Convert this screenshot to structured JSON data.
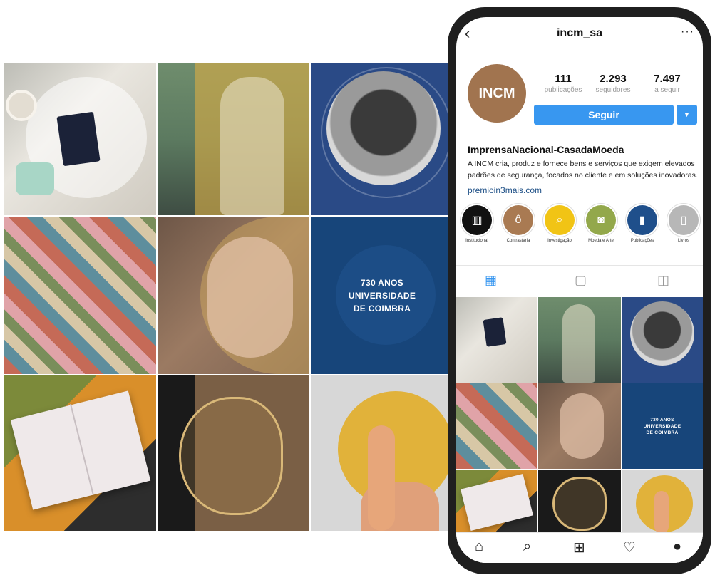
{
  "grid": {
    "tile6_text": [
      "730 ANOS",
      "UNIVERSIDADE",
      "DE COIMBRA"
    ]
  },
  "phone": {
    "topbar": {
      "back_icon": "chevron-left-icon",
      "username": "incm_sa",
      "more_icon": "ellipsis-icon"
    },
    "profile": {
      "logo_text": "INCM",
      "stats": [
        {
          "value": "111",
          "label": "publicações"
        },
        {
          "value": "2.293",
          "label": "seguidores"
        },
        {
          "value": "7.497",
          "label": "a seguir"
        }
      ],
      "follow_label": "Seguir",
      "name": "ImprensaNacional-CasadaMoeda",
      "bio": "A INCM cria, produz e fornece bens e serviços que exigem elevados padrões de segurança, focados no cliente e em soluções inovadoras.",
      "link": "premioin3mais.com"
    },
    "highlights": [
      {
        "label": "Institucional",
        "color": "#111111",
        "icon": "bank-icon"
      },
      {
        "label": "Contrastaria",
        "color": "#a97a52",
        "icon": "ring-icon"
      },
      {
        "label": "Investigação",
        "color": "#f1c415",
        "icon": "magnifier-icon"
      },
      {
        "label": "Moeda e Arte",
        "color": "#93a84b",
        "icon": "coin-icon"
      },
      {
        "label": "Publicações",
        "color": "#1f4f8b",
        "icon": "book-icon"
      },
      {
        "label": "Livros",
        "color": "#b7b7b7",
        "icon": "book-icon"
      }
    ],
    "grid_tile6_text": [
      "730 ANOS",
      "UNIVERSIDADE",
      "DE COIMBRA"
    ]
  }
}
